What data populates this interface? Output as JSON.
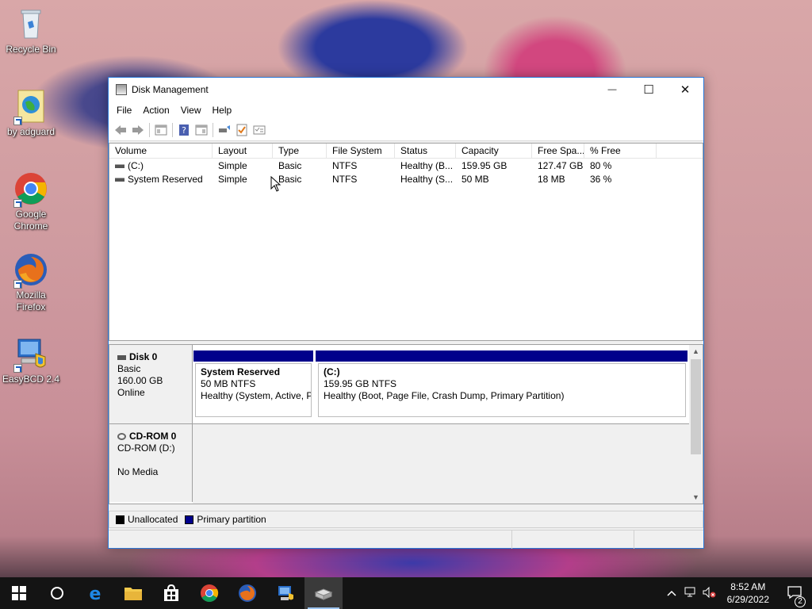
{
  "desktop": {
    "icons": [
      {
        "label": "Recycle Bin"
      },
      {
        "label": "by adguard"
      },
      {
        "label": "Google Chrome"
      },
      {
        "label": "Mozilla Firefox"
      },
      {
        "label": "EasyBCD 2.4"
      }
    ]
  },
  "window": {
    "title": "Disk Management",
    "controls": {
      "minimize": "—",
      "maximize": "☐",
      "close": "✕"
    }
  },
  "menu": [
    "File",
    "Action",
    "View",
    "Help"
  ],
  "volume_list": {
    "columns": [
      "Volume",
      "Layout",
      "Type",
      "File System",
      "Status",
      "Capacity",
      "Free Spa...",
      "% Free"
    ],
    "rows": [
      [
        "(C:)",
        "Simple",
        "Basic",
        "NTFS",
        "Healthy (B...",
        "159.95 GB",
        "127.47 GB",
        "80 %"
      ],
      [
        "System Reserved",
        "Simple",
        "Basic",
        "NTFS",
        "Healthy (S...",
        "50 MB",
        "18 MB",
        "36 %"
      ]
    ]
  },
  "disks": {
    "disk0": {
      "name": "Disk 0",
      "type": "Basic",
      "size": "160.00 GB",
      "state": "Online",
      "partitions": [
        {
          "name": "System Reserved",
          "size": "50 MB NTFS",
          "status": "Healthy (System, Active, P"
        },
        {
          "name": "(C:)",
          "size": "159.95 GB NTFS",
          "status": "Healthy (Boot, Page File, Crash Dump, Primary Partition)"
        }
      ]
    },
    "cdrom0": {
      "name": "CD-ROM 0",
      "type": "CD-ROM (D:)",
      "media": "No Media"
    }
  },
  "legend": [
    {
      "label": "Unallocated",
      "color": "#000000"
    },
    {
      "label": "Primary partition",
      "color": "#00008b"
    }
  ],
  "taskbar": {
    "clock_time": "8:52 AM",
    "clock_date": "6/29/2022",
    "notification_count": "2"
  }
}
